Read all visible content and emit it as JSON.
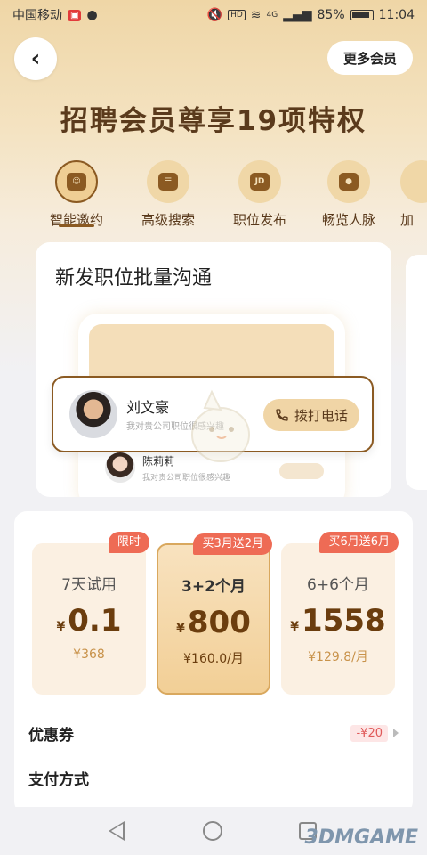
{
  "status_bar": {
    "carrier": "中国移动",
    "battery": "85%",
    "time": "11:04",
    "net": "4G",
    "hd": "HD"
  },
  "header": {
    "back_icon": "chevron-left-icon",
    "more_label": "更多会员",
    "title": "招聘会员尊享19项特权"
  },
  "tabs": [
    {
      "label": "智能邀约",
      "icon": "chat-robot-icon",
      "active": true
    },
    {
      "label": "高级搜索",
      "icon": "search-list-icon",
      "active": false
    },
    {
      "label": "职位发布",
      "icon": "jd-briefcase-icon",
      "active": false
    },
    {
      "label": "畅览人脉",
      "icon": "person-icon",
      "active": false
    },
    {
      "label": "加",
      "icon": "partial-icon",
      "active": false
    }
  ],
  "feature": {
    "title": "新发职位批量沟通",
    "contact_1": {
      "name": "刘文豪",
      "sub": "我对贵公司职位很感兴趣"
    },
    "call_label": "拨打电话",
    "contact_2": {
      "name": "陈莉莉",
      "sub": "我对贵公司职位很感兴趣"
    }
  },
  "plans": [
    {
      "tag": "限时",
      "name": "7天试用",
      "currency": "¥",
      "price": "0.1",
      "per": "¥368",
      "selected": false
    },
    {
      "tag": "买3月送2月",
      "name": "3+2个月",
      "currency": "¥",
      "price": "800",
      "per": "¥160.0/月",
      "selected": true
    },
    {
      "tag": "买6月送6月",
      "name": "6+6个月",
      "currency": "¥",
      "price": "1558",
      "per": "¥129.8/月",
      "selected": false
    }
  ],
  "coupon": {
    "label": "优惠券",
    "value": "-¥20"
  },
  "payment": {
    "label": "支付方式"
  },
  "watermark": "3DMGAME",
  "colors": {
    "brand_brown": "#8b5a22",
    "gold": "#f0d5a6",
    "tag_red": "#ee6b55"
  }
}
